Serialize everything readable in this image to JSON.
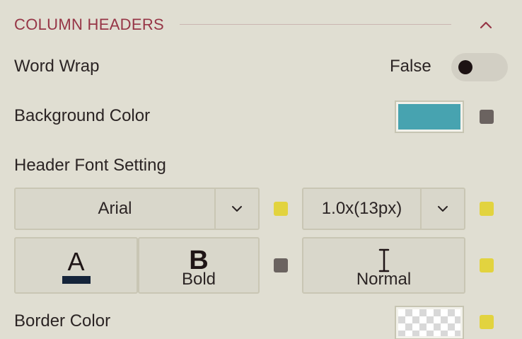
{
  "section": {
    "title": "COLUMN HEADERS",
    "collapse_icon": "chevron-up-icon"
  },
  "word_wrap": {
    "label": "Word Wrap",
    "state_text": "False",
    "enabled": false
  },
  "background_color": {
    "label": "Background Color",
    "swatch_color": "#47a3b0",
    "indicator_color": "#6b6360"
  },
  "header_font": {
    "label": "Header Font Setting",
    "font_family": {
      "value": "Arial",
      "caret_icon": "chevron-down-icon",
      "indicator_color": "#e2d33f"
    },
    "font_size": {
      "value": "1.0x(13px)",
      "caret_icon": "chevron-down-icon",
      "indicator_color": "#e2d33f"
    },
    "font_color": {
      "glyph": "A",
      "underline_color": "#15243a"
    },
    "font_weight": {
      "glyph": "B",
      "caption": "Bold",
      "indicator_color": "#6b6360"
    },
    "font_style": {
      "icon": "text-cursor-icon",
      "caption": "Normal",
      "indicator_color": "#e2d33f"
    }
  },
  "border_color": {
    "label": "Border Color",
    "swatch": "transparent",
    "indicator_color": "#e2d33f"
  },
  "colors": {
    "accent": "#963546",
    "background": "#e0ded2"
  }
}
